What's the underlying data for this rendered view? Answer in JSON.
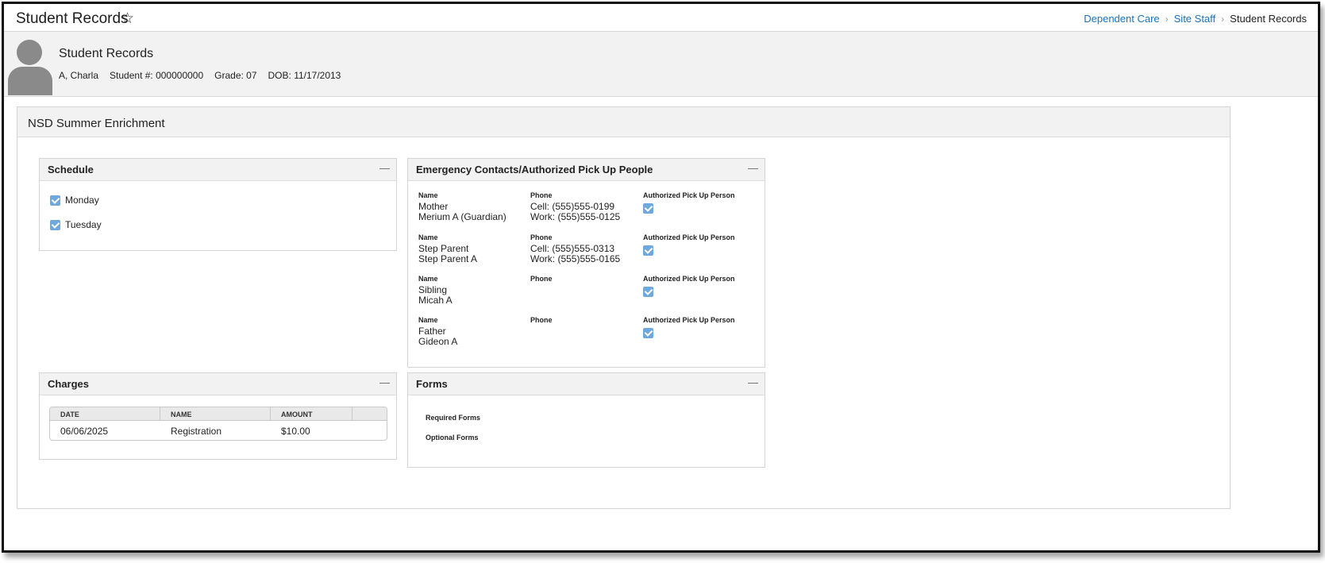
{
  "header": {
    "title": "Student Records",
    "star_icon": "☆",
    "breadcrumb": [
      "Dependent Care",
      "Site Staff",
      "Student Records"
    ],
    "sep": "›"
  },
  "banner": {
    "title": "Student Records",
    "name": "A, Charla",
    "student_number": "Student #: 000000000",
    "grade": "Grade: 07",
    "dob": "DOB: 11/17/2013"
  },
  "program": {
    "title": "NSD Summer Enrichment"
  },
  "schedule": {
    "title": "Schedule",
    "collapse": "—",
    "days": [
      {
        "label": "Monday",
        "checked": true
      },
      {
        "label": "Tuesday",
        "checked": true
      }
    ]
  },
  "contacts": {
    "title": "Emergency Contacts/Authorized Pick Up People",
    "collapse": "—",
    "col_name": "Name",
    "col_phone": "Phone",
    "col_auth": "Authorized Pick Up Person",
    "items": [
      {
        "relation": "Mother",
        "name": "Merium A (Guardian)",
        "phone1": "Cell: (555)555-0199",
        "phone2": "Work: (555)555-0125",
        "authorized": true
      },
      {
        "relation": "Step Parent",
        "name": "Step Parent A",
        "phone1": "Cell: (555)555-0313",
        "phone2": "Work: (555)555-0165",
        "authorized": true
      },
      {
        "relation": "Sibling",
        "name": "Micah A",
        "phone1": "",
        "phone2": "",
        "authorized": true
      },
      {
        "relation": "Father",
        "name": "Gideon A",
        "phone1": "",
        "phone2": "",
        "authorized": true
      }
    ]
  },
  "charges": {
    "title": "Charges",
    "collapse": "—",
    "columns": [
      "DATE",
      "NAME",
      "AMOUNT"
    ],
    "rows": [
      {
        "date": "06/06/2025",
        "name": "Registration",
        "amount": "$10.00"
      }
    ]
  },
  "forms": {
    "title": "Forms",
    "collapse": "—",
    "required": "Required Forms",
    "optional": "Optional Forms"
  },
  "colors": {
    "link": "#1a73b8",
    "checkbox": "#6fa8dc",
    "panel_header": "#f2f2f2"
  }
}
